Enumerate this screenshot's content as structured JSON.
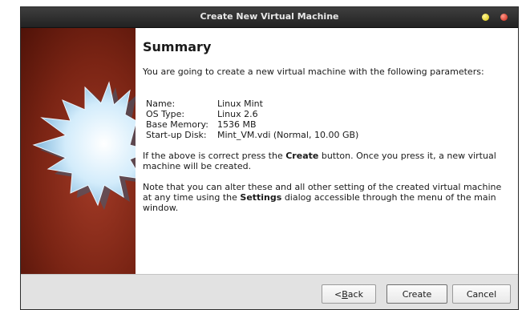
{
  "window": {
    "title": "Create New Virtual Machine"
  },
  "summary": {
    "heading": "Summary",
    "intro": "You are going to create a new virtual machine with the following parameters:",
    "details": [
      {
        "key": "Name:",
        "value": "Linux Mint"
      },
      {
        "key": "OS Type:",
        "value": "Linux 2.6"
      },
      {
        "key": "Base Memory:",
        "value": "1536 MB"
      },
      {
        "key": "Start-up Disk:",
        "value": "Mint_VM.vdi (Normal, 10.00 GB)"
      }
    ],
    "confirm_pre": "If the above is correct press the ",
    "confirm_bold": "Create",
    "confirm_post": " button. Once you press it, a new virtual machine will be created.",
    "note_pre": "Note that you can alter these and all other setting of the created virtual machine at any time using the ",
    "note_bold": "Settings",
    "note_post": " dialog accessible through the menu of the main window."
  },
  "buttons": {
    "back_prefix": "< ",
    "back_mnemonic": "B",
    "back_rest": "ack",
    "create": "Create",
    "cancel": "Cancel"
  },
  "colors": {
    "sidepanel": "#7a2414",
    "starburst": "#bfe0f5"
  },
  "icons": {
    "minimize": "yellow-circle",
    "close": "red-circle",
    "wizard_art": "starburst"
  }
}
